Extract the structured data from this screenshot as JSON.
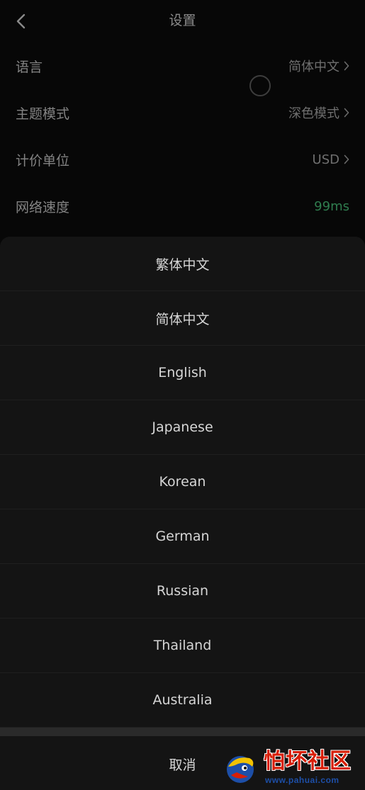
{
  "header": {
    "title": "设置",
    "back_icon": "chevron-left-icon"
  },
  "settings": [
    {
      "label": "语言",
      "value": "简体中文",
      "has_chevron": true
    },
    {
      "label": "主题模式",
      "value": "深色模式",
      "has_chevron": true
    },
    {
      "label": "计价单位",
      "value": "USD",
      "has_chevron": true
    },
    {
      "label": "网络速度",
      "value": "99ms",
      "has_chevron": false
    }
  ],
  "language_sheet": {
    "options": [
      "繁体中文",
      "简体中文",
      "English",
      "Japanese",
      "Korean",
      "German",
      "Russian",
      "Thailand",
      "Australia"
    ],
    "cancel_label": "取消"
  },
  "watermark": {
    "text": "怕坏社区",
    "url": "www.pahuai.com"
  },
  "colors": {
    "background": "#070707",
    "sheet_background": "#141414",
    "ping_green": "#2f7d4f",
    "watermark_red": "#d81e06",
    "watermark_blue": "#1d4fa8"
  }
}
